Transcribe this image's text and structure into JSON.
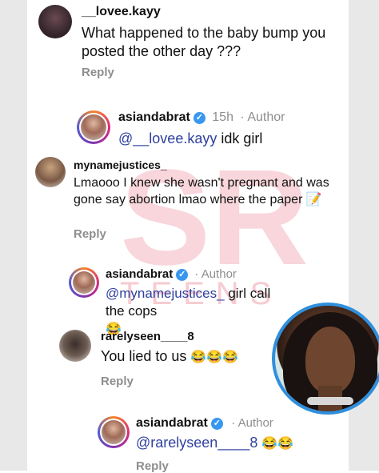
{
  "comments": [
    {
      "username": "__lovee.kayy",
      "text": "What happened to the baby bump you posted the other day ???",
      "reply_label": "Reply"
    },
    {
      "username": "asiandabrat",
      "time": "15h",
      "author_label": "· Author",
      "mention": "@__lovee.kayy",
      "text": " idk girl"
    },
    {
      "username": "mynamejustices_",
      "text": "Lmaooo I knew she wasn't pregnant and was gone say abortion lmao where the paper ",
      "emoji": "📝",
      "reply_label": "Reply"
    },
    {
      "username": "asiandabrat",
      "author_label": "· Author",
      "mention": "@mynamejustices_",
      "text": " girl call the cops",
      "emoji": "😂"
    },
    {
      "username": "rarelyseen____8",
      "text": "You lied to us ",
      "emoji": "😂😂😂",
      "reply_label": "Reply"
    },
    {
      "username": "asiandabrat",
      "author_label": "· Author",
      "mention": "@rarelyseen____8",
      "emoji": "😂😂",
      "reply_label": "Reply"
    }
  ],
  "watermark": {
    "main": "SR",
    "sub": "TEENS"
  },
  "icons": {
    "verified": "verified-badge-icon"
  }
}
